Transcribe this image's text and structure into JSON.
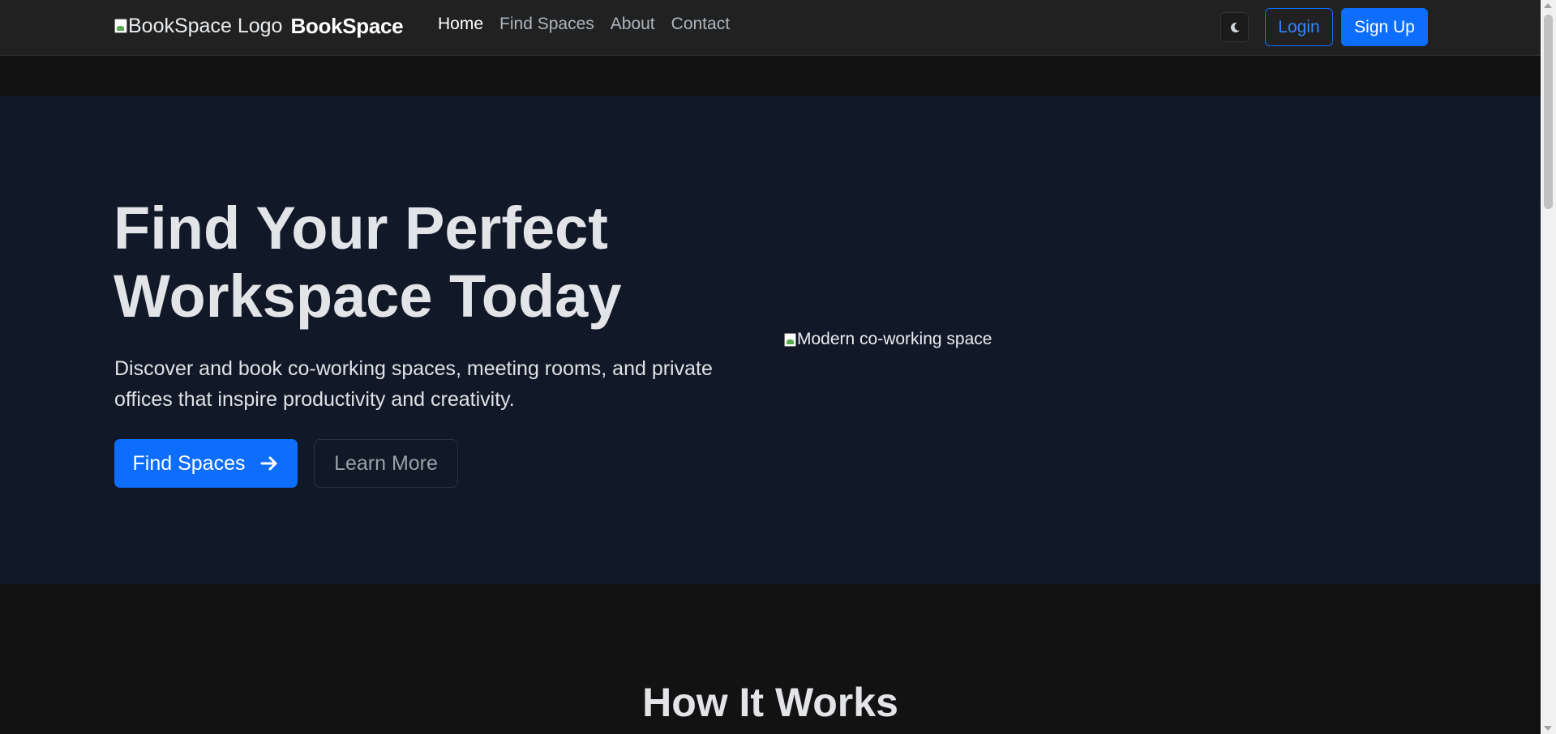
{
  "navbar": {
    "logo_alt": "BookSpace Logo",
    "brand_name": "BookSpace",
    "links": [
      {
        "label": "Home"
      },
      {
        "label": "Find Spaces"
      },
      {
        "label": "About"
      },
      {
        "label": "Contact"
      }
    ],
    "theme_toggle_icon": "moon-icon",
    "login_label": "Login",
    "signup_label": "Sign Up"
  },
  "hero": {
    "title_line1": "Find Your Perfect",
    "title_line2": "Workspace Today",
    "subtitle_line1": "Discover and book co-working spaces, meeting rooms, and private",
    "subtitle_line2": "offices that inspire productivity and creativity.",
    "find_button_label": "Find Spaces",
    "find_button_icon": "arrow-right-icon",
    "learn_button_label": "Learn More",
    "image_alt": "Modern co-working space"
  },
  "how_it_works": {
    "title": "How It Works"
  },
  "colors": {
    "primary": "#0d6efd",
    "navbar_bg": "#212121",
    "hero_bg": "#111827",
    "page_bg": "#121212"
  }
}
